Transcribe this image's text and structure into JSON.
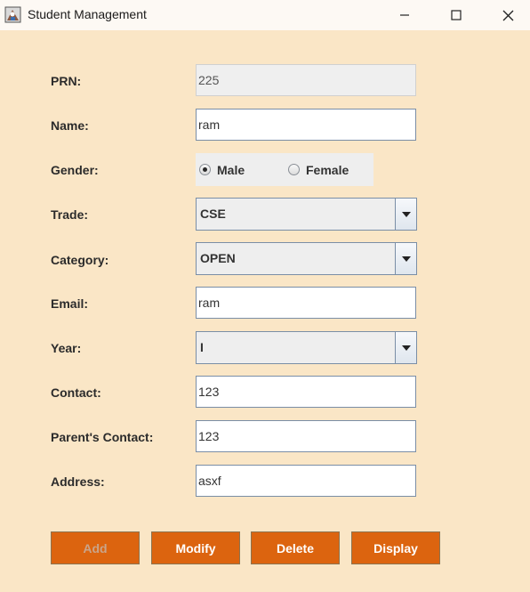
{
  "window": {
    "title": "Student Management"
  },
  "title_bar": {
    "icons": [
      "app-icon",
      "minimize-icon",
      "maximize-icon",
      "close-icon"
    ]
  },
  "form": {
    "prn": {
      "label": "PRN:",
      "value": "225"
    },
    "name": {
      "label": "Name:",
      "value": "ram"
    },
    "gender": {
      "label": "Gender:",
      "options": [
        "Male",
        "Female"
      ],
      "selected": "Male"
    },
    "trade": {
      "label": "Trade:",
      "value": "CSE"
    },
    "category": {
      "label": "Category:",
      "value": "OPEN"
    },
    "email": {
      "label": "Email:",
      "value": "ram"
    },
    "year": {
      "label": "Year:",
      "value": "I"
    },
    "contact": {
      "label": "Contact:",
      "value": "123"
    },
    "parents_contact": {
      "label": "Parent's Contact:",
      "value": "123"
    },
    "address": {
      "label": "Address:",
      "value": "asxf"
    }
  },
  "buttons": {
    "add": "Add",
    "modify": "Modify",
    "delete": "Delete",
    "display": "Display"
  },
  "colors": {
    "background": "#fae6c6",
    "button": "#dc640f",
    "title_bar": "#fdf9f4"
  }
}
